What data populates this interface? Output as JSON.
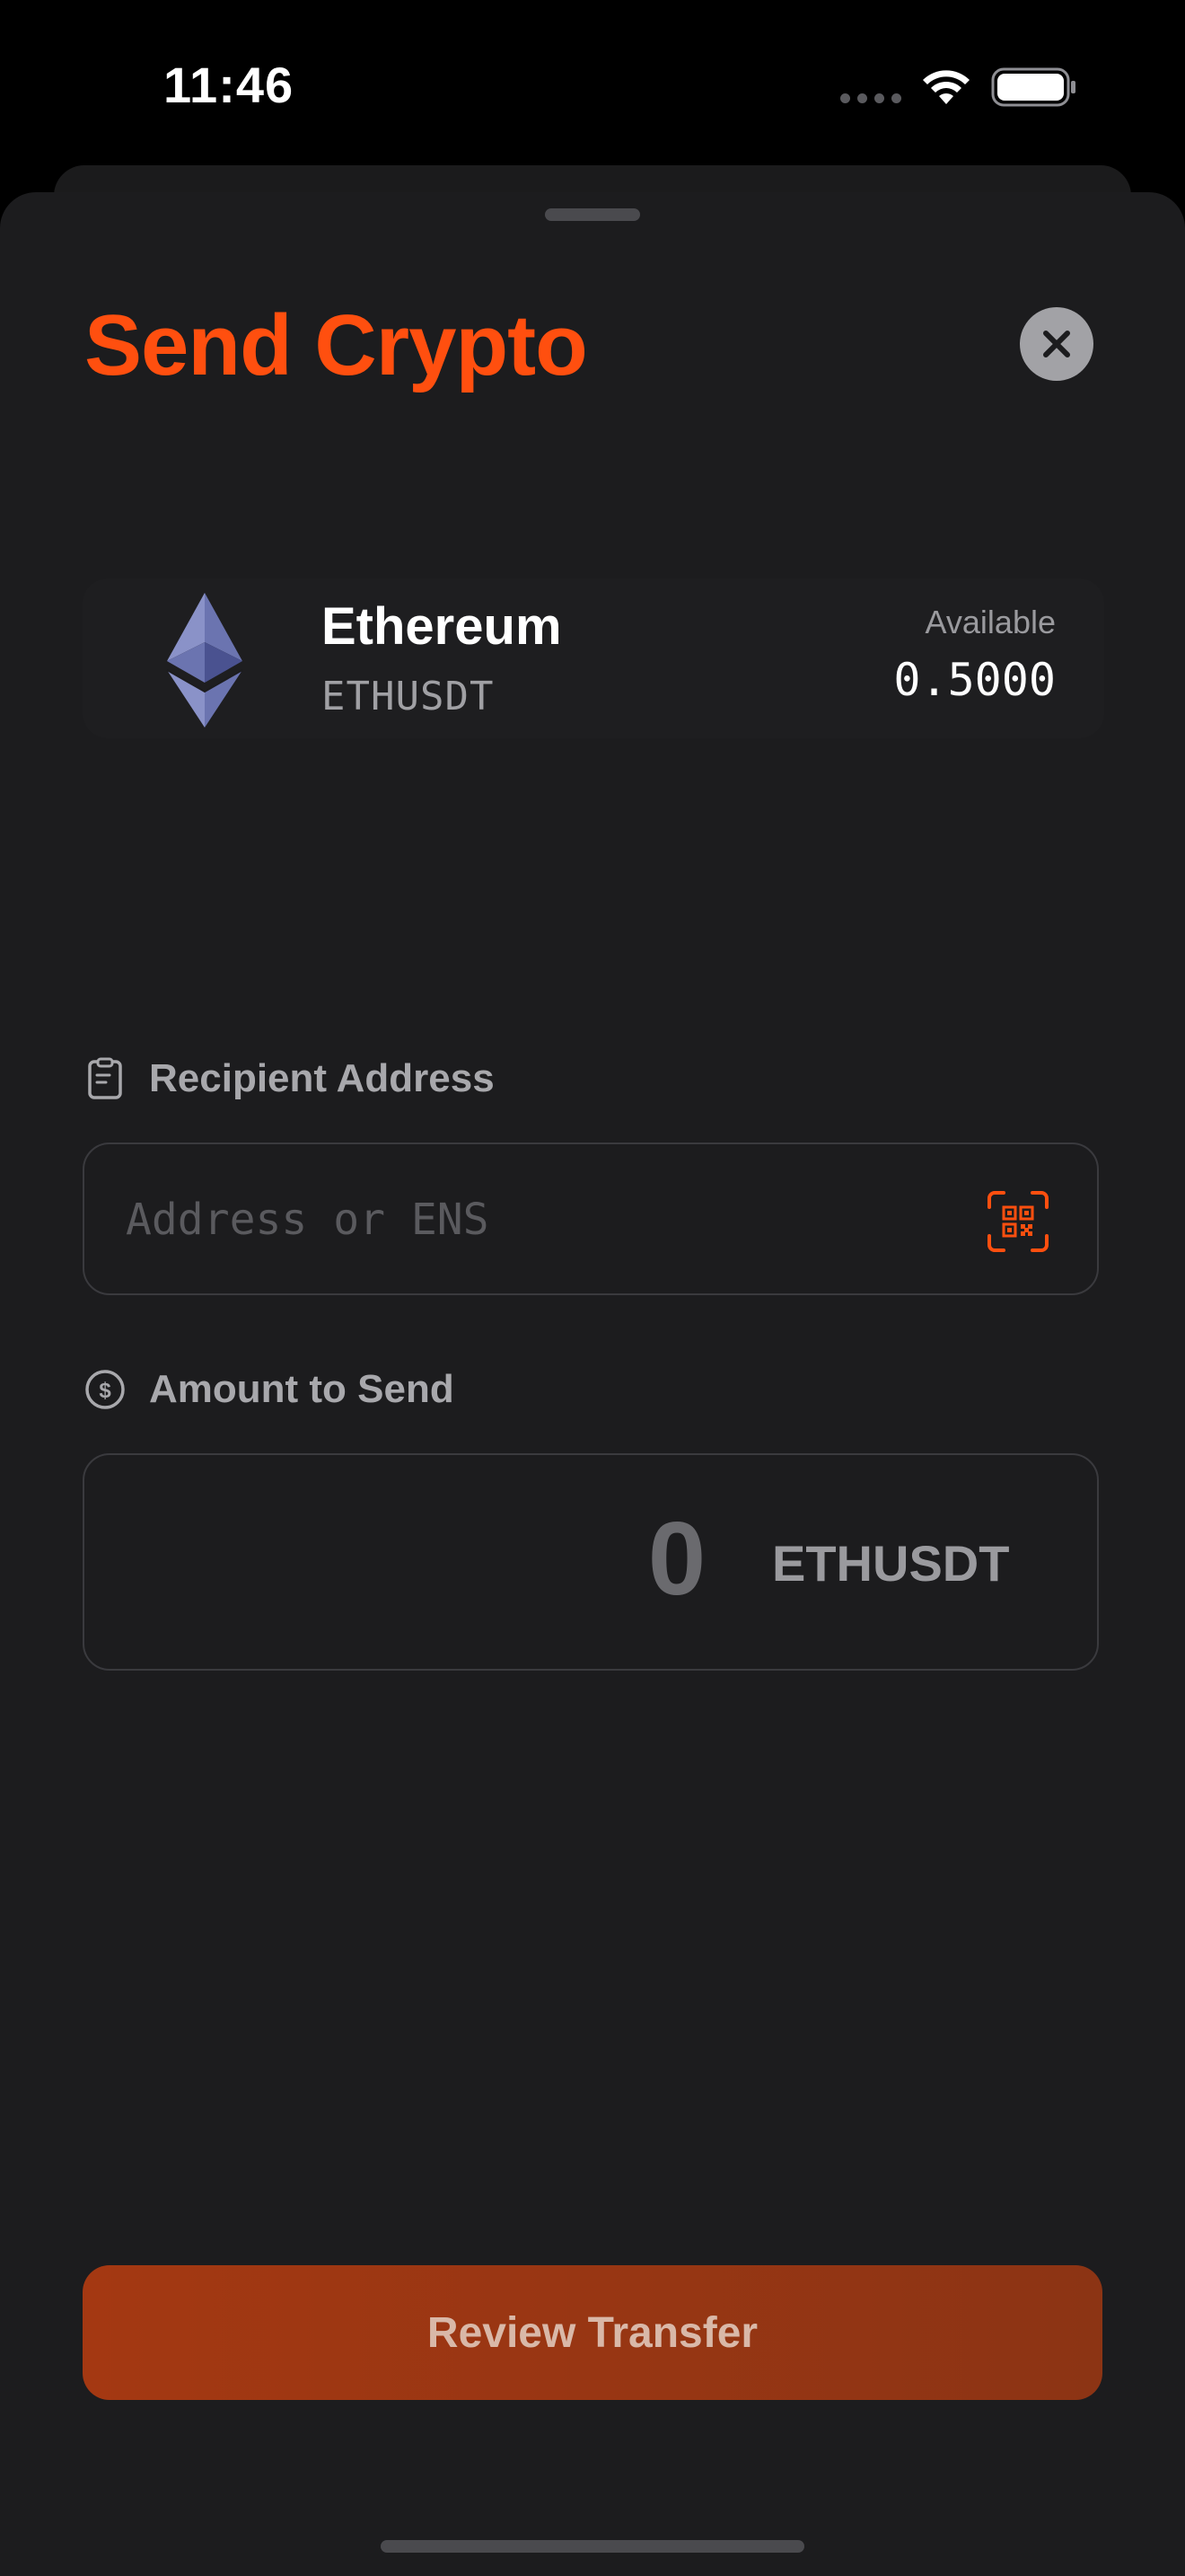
{
  "status_bar": {
    "time": "11:46",
    "icons": [
      "signal-dots-icon",
      "wifi-icon",
      "battery-icon"
    ]
  },
  "sheet": {
    "title": "Send Crypto",
    "close_icon": "close-icon"
  },
  "asset": {
    "name": "Ethereum",
    "symbol": "ETHUSDT",
    "available_label": "Available",
    "available_value": "0.5000",
    "icon": "ethereum-icon"
  },
  "recipient": {
    "label": "Recipient Address",
    "label_icon": "clipboard-icon",
    "value": "",
    "placeholder": "Address or ENS",
    "scan_icon": "qr-scan-icon"
  },
  "amount": {
    "label": "Amount to Send",
    "label_icon": "dollar-circle-icon",
    "value": "0",
    "unit": "ETHUSDT"
  },
  "actions": {
    "review_label": "Review Transfer"
  },
  "colors": {
    "accent": "#ff4f0f",
    "background": "#1c1c1e",
    "button": "#9c3612"
  }
}
